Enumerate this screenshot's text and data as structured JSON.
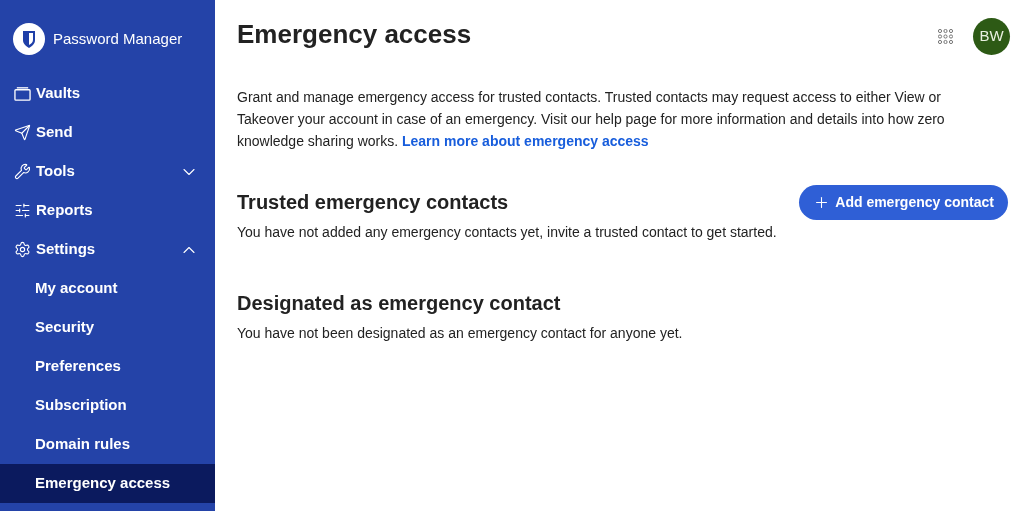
{
  "sidebar": {
    "logo": "Password Manager",
    "items": [
      {
        "label": "Vaults",
        "selected": false
      },
      {
        "label": "Send",
        "selected": false
      },
      {
        "label": "Tools",
        "selected": false,
        "expanded": false
      },
      {
        "label": "Reports",
        "selected": false
      },
      {
        "label": "Settings",
        "selected": false,
        "expanded": true,
        "children": [
          {
            "label": "My account",
            "selected": false
          },
          {
            "label": "Security",
            "selected": false
          },
          {
            "label": "Preferences",
            "selected": false
          },
          {
            "label": "Subscription",
            "selected": false
          },
          {
            "label": "Domain rules",
            "selected": false
          },
          {
            "label": "Emergency access",
            "selected": true
          }
        ]
      }
    ]
  },
  "header": {
    "title": "Emergency access",
    "avatar": "BW"
  },
  "intro": {
    "text": "Grant and manage emergency access for trusted contacts. Trusted contacts may request access to either View or Takeover your account in case of an emergency. Visit our help page for more information and details into how zero knowledge sharing works.",
    "link": "Learn more about emergency access"
  },
  "sections": [
    {
      "title": "Trusted emergency contacts",
      "button": "Add emergency contact",
      "message": "You have not added any emergency contacts yet, invite a trusted contact to get started."
    },
    {
      "title": "Designated as emergency contact",
      "message": "You have not been designated as an emergency contact for anyone yet."
    }
  ]
}
